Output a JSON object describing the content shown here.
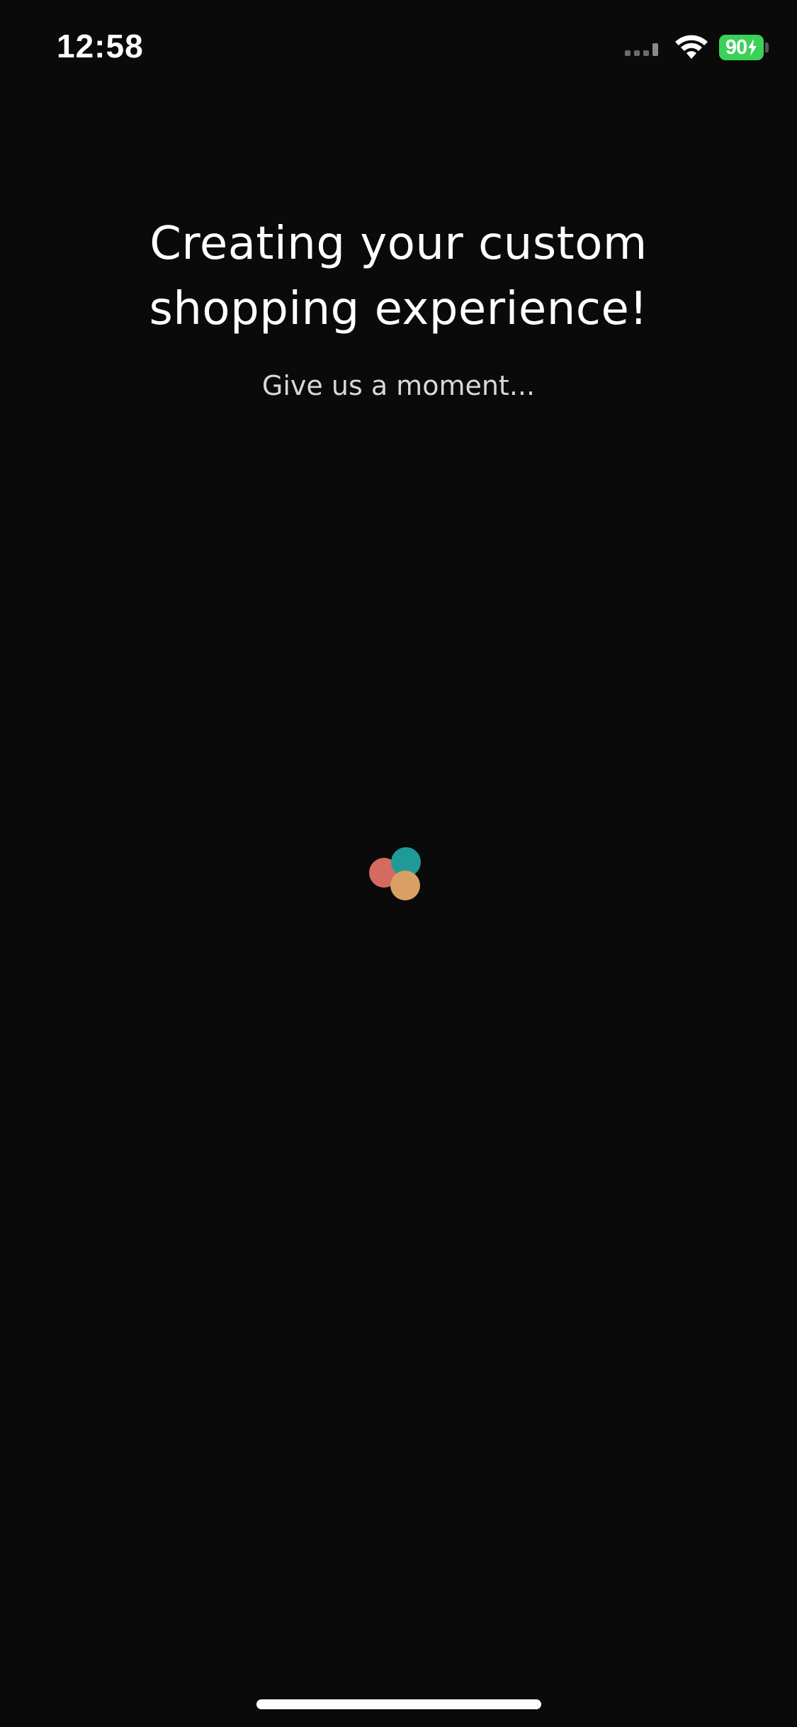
{
  "status_bar": {
    "time": "12:58",
    "battery_level": "90",
    "battery_charging": true,
    "battery_color": "#3ad157",
    "icons": [
      "signal-icon",
      "wifi-icon",
      "battery-icon"
    ]
  },
  "loading_screen": {
    "headline_line1": "Creating your custom",
    "headline_line2": "shopping experience!",
    "subtitle": "Give us a moment..."
  },
  "loader": {
    "icon": "loading-dots-icon",
    "colors": {
      "red": "#d46a60",
      "teal": "#1f9a98",
      "gold": "#d9a064"
    }
  }
}
